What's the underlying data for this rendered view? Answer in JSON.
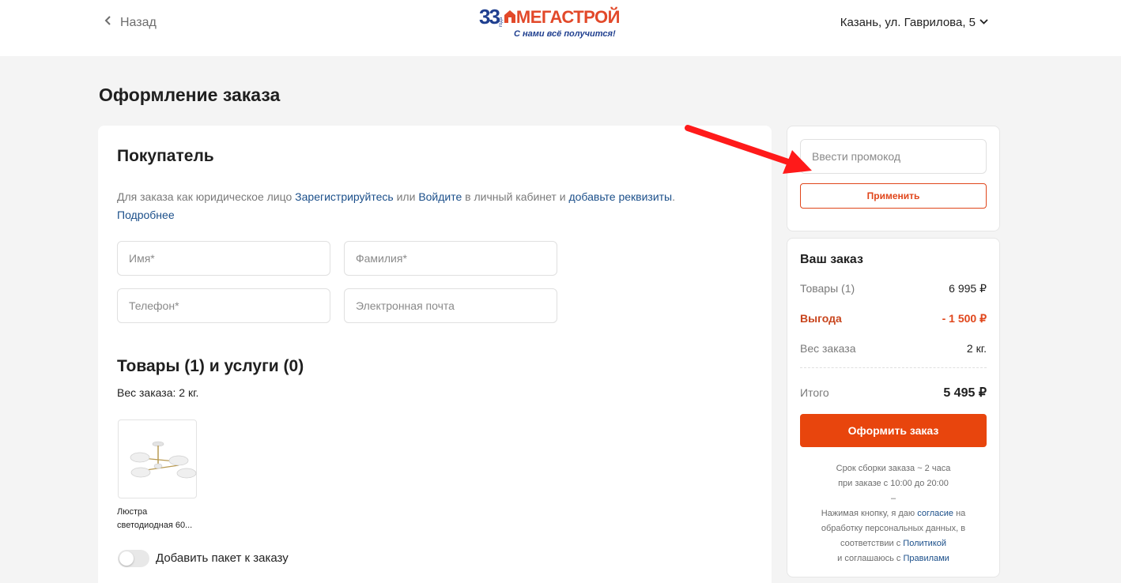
{
  "header": {
    "back_label": "Назад",
    "logo": {
      "number": "33",
      "goda": "года",
      "name": "МЕГАСТРОЙ",
      "slogan": "С нами всё получится!"
    },
    "city": "Казань, ул. Гаврилова, 5"
  },
  "page_title": "Оформление заказа",
  "buyer": {
    "title": "Покупатель",
    "info": {
      "t1": "Для заказа как юридическое лицо ",
      "link_register": "Зарегистрируйтесь",
      "t2": " или ",
      "link_login": "Войдите",
      "t3": " в личный кабинет и ",
      "link_requisites": "добавьте реквизиты",
      "t4": ".",
      "link_more": "Подробнее"
    },
    "fields": {
      "first_name": "Имя*",
      "last_name": "Фамилия*",
      "phone": "Телефон*",
      "email": "Электронная почта"
    }
  },
  "goods": {
    "title": "Товары (1) и услуги (0)",
    "weight": "Вес заказа: 2 кг.",
    "product_name": "Люстра светодиодная 60...",
    "package_toggle_label": "Добавить пакет к заказу",
    "package_toggle_on": false
  },
  "promo": {
    "placeholder": "Ввести промокод",
    "apply_label": "Применить"
  },
  "order": {
    "title": "Ваш заказ",
    "items_label": "Товары (1)",
    "items_value": "6 995 ₽",
    "discount_label": "Выгода",
    "discount_value": "- 1 500 ₽",
    "weight_label": "Вес заказа",
    "weight_value": "2 кг.",
    "total_label": "Итого",
    "total_value": "5 495 ₽",
    "submit_label": "Оформить заказ",
    "note": {
      "assembly_1": "Срок сборки заказа ~ 2 часа",
      "assembly_2": "при заказе с 10:00 до 20:00",
      "dash": "–",
      "c1": "Нажимая кнопку, я даю ",
      "link_consent": "согласие",
      "c2": " на обработку персональных данных, в соответствии с ",
      "link_policy": "Политикой",
      "c3": " и соглашаюсь с ",
      "link_rules": "Правилами"
    }
  },
  "colors": {
    "accent": "#e8450d",
    "link": "#1b4f8a",
    "discount": "#e0461b",
    "logo_blue": "#1f3f8f",
    "annotation": "#ff1a1a"
  }
}
